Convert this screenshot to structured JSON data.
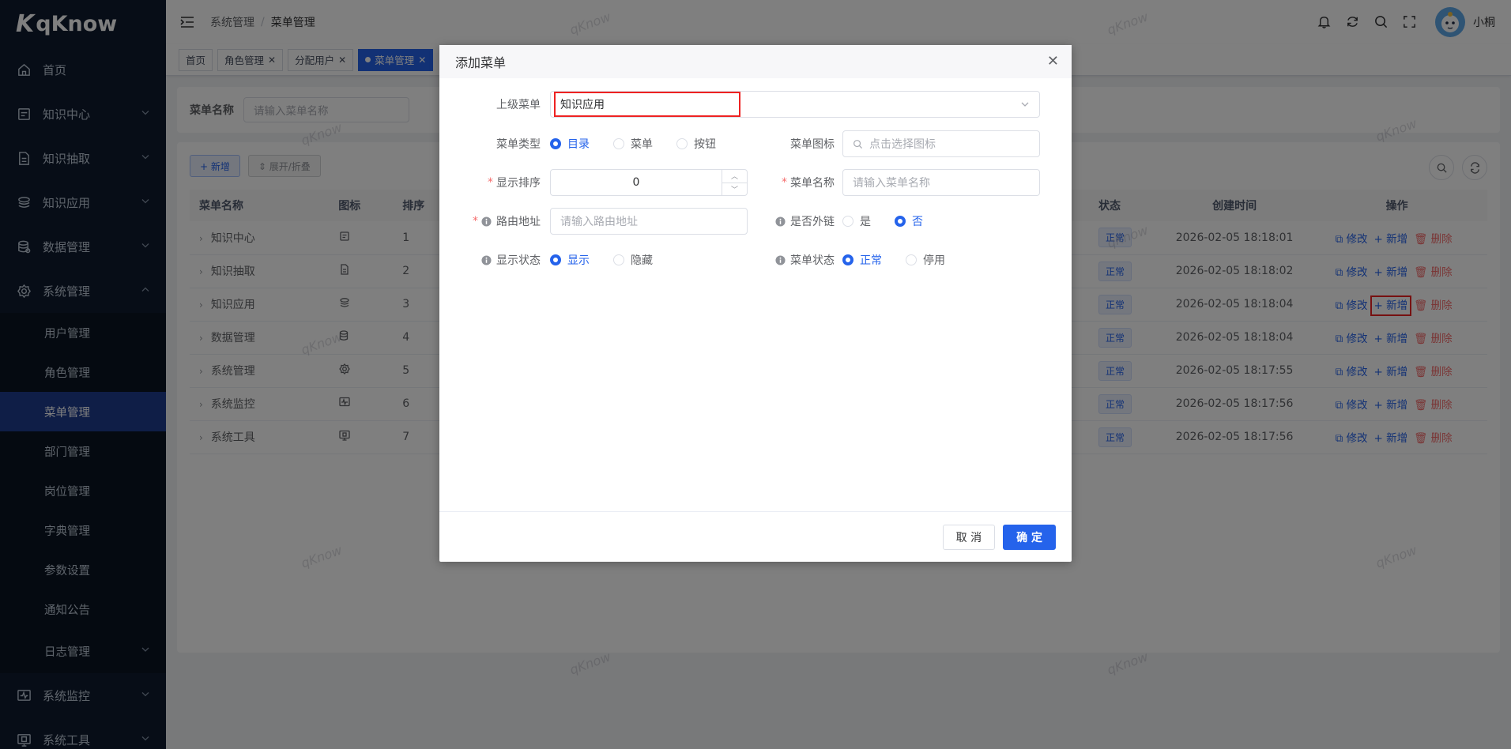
{
  "app": {
    "logo_text": "qKnow",
    "logo_mark": "K"
  },
  "sidebar": {
    "items": [
      {
        "label": "首页",
        "icon": "home-icon"
      },
      {
        "label": "知识中心",
        "icon": "book-icon"
      },
      {
        "label": "知识抽取",
        "icon": "document-icon"
      },
      {
        "label": "知识应用",
        "icon": "stack-icon"
      },
      {
        "label": "数据管理",
        "icon": "database-icon"
      },
      {
        "label": "系统管理",
        "icon": "gear-icon"
      }
    ],
    "sub_items": [
      "用户管理",
      "角色管理",
      "菜单管理",
      "部门管理",
      "岗位管理",
      "字典管理",
      "参数设置",
      "通知公告",
      "日志管理"
    ],
    "bottom_items": [
      {
        "label": "系统监控",
        "icon": "monitor-icon"
      },
      {
        "label": "系统工具",
        "icon": "tools-icon"
      }
    ]
  },
  "header": {
    "breadcrumb": [
      "系统管理",
      "菜单管理"
    ],
    "separator": "/",
    "username": "小桐"
  },
  "tags": [
    {
      "label": "首页"
    },
    {
      "label": "角色管理"
    },
    {
      "label": "分配用户"
    },
    {
      "label": "菜单管理"
    }
  ],
  "search": {
    "label": "菜单名称",
    "placeholder": "请输入菜单名称"
  },
  "toolbar": {
    "add_label": "+ 新增",
    "expand_label": "⇕ 展开/折叠"
  },
  "table": {
    "columns": {
      "name": "菜单名称",
      "icon": "图标",
      "order": "排序",
      "status": "状态",
      "created": "创建时间",
      "ops": "操作"
    },
    "rows": [
      {
        "name": "知识中心",
        "order": "1",
        "status": "正常",
        "created": "2026-02-05 18:18:01"
      },
      {
        "name": "知识抽取",
        "order": "2",
        "status": "正常",
        "created": "2026-02-05 18:18:02"
      },
      {
        "name": "知识应用",
        "order": "3",
        "status": "正常",
        "created": "2026-02-05 18:18:04"
      },
      {
        "name": "数据管理",
        "order": "4",
        "status": "正常",
        "created": "2026-02-05 18:18:04"
      },
      {
        "name": "系统管理",
        "order": "5",
        "status": "正常",
        "created": "2026-02-05 18:17:55"
      },
      {
        "name": "系统监控",
        "order": "6",
        "status": "正常",
        "created": "2026-02-05 18:17:56"
      },
      {
        "name": "系统工具",
        "order": "7",
        "status": "正常",
        "created": "2026-02-05 18:17:56"
      }
    ],
    "op_edit": "修改",
    "op_add": "新增",
    "op_delete": "删除"
  },
  "dialog": {
    "title": "添加菜单",
    "parent_label": "上级菜单",
    "parent_value": "知识应用",
    "type_label": "菜单类型",
    "type_options": [
      "目录",
      "菜单",
      "按钮"
    ],
    "icon_label": "菜单图标",
    "icon_placeholder": "点击选择图标",
    "order_label": "显示排序",
    "order_value": "0",
    "name_label": "菜单名称",
    "name_placeholder": "请输入菜单名称",
    "path_label": "路由地址",
    "path_placeholder": "请输入路由地址",
    "external_label": "是否外链",
    "external_options": [
      "是",
      "否"
    ],
    "visible_label": "显示状态",
    "visible_options": [
      "显示",
      "隐藏"
    ],
    "status_label": "菜单状态",
    "status_options": [
      "正常",
      "停用"
    ],
    "cancel_label": "取 消",
    "ok_label": "确 定"
  },
  "watermark": "qKnow",
  "colors": {
    "primary": "#2563eb",
    "sidebar_bg": "#0f1a2e",
    "active_menu": "#1e3d8f",
    "danger": "#f56c6c",
    "highlight": "#ee2222"
  }
}
